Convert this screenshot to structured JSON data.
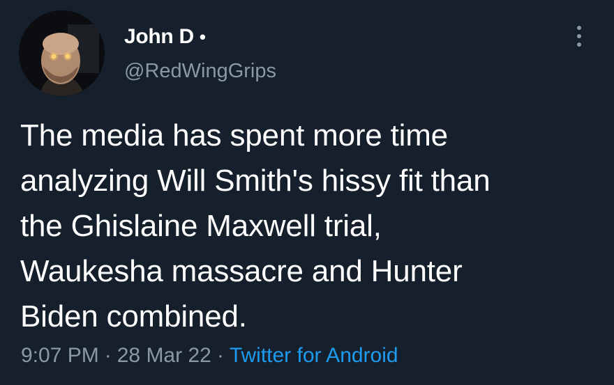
{
  "author": {
    "display_name": "John D",
    "name_dot": "•",
    "handle": "@RedWingGrips"
  },
  "tweet": {
    "lines": [
      "The media has spent more time",
      "analyzing Will Smith's hissy fit than",
      "the Ghislaine Maxwell trial,",
      "Waukesha massacre and Hunter",
      "Biden combined."
    ]
  },
  "meta": {
    "time": "9:07 PM",
    "separator": "·",
    "date": "28 Mar 22",
    "source": "Twitter for Android"
  },
  "colors": {
    "background": "#16202c",
    "text": "#ffffff",
    "secondary_text": "#8b98a5",
    "link": "#1d9bf0"
  },
  "icons": {
    "more": "more-vertical-icon"
  }
}
